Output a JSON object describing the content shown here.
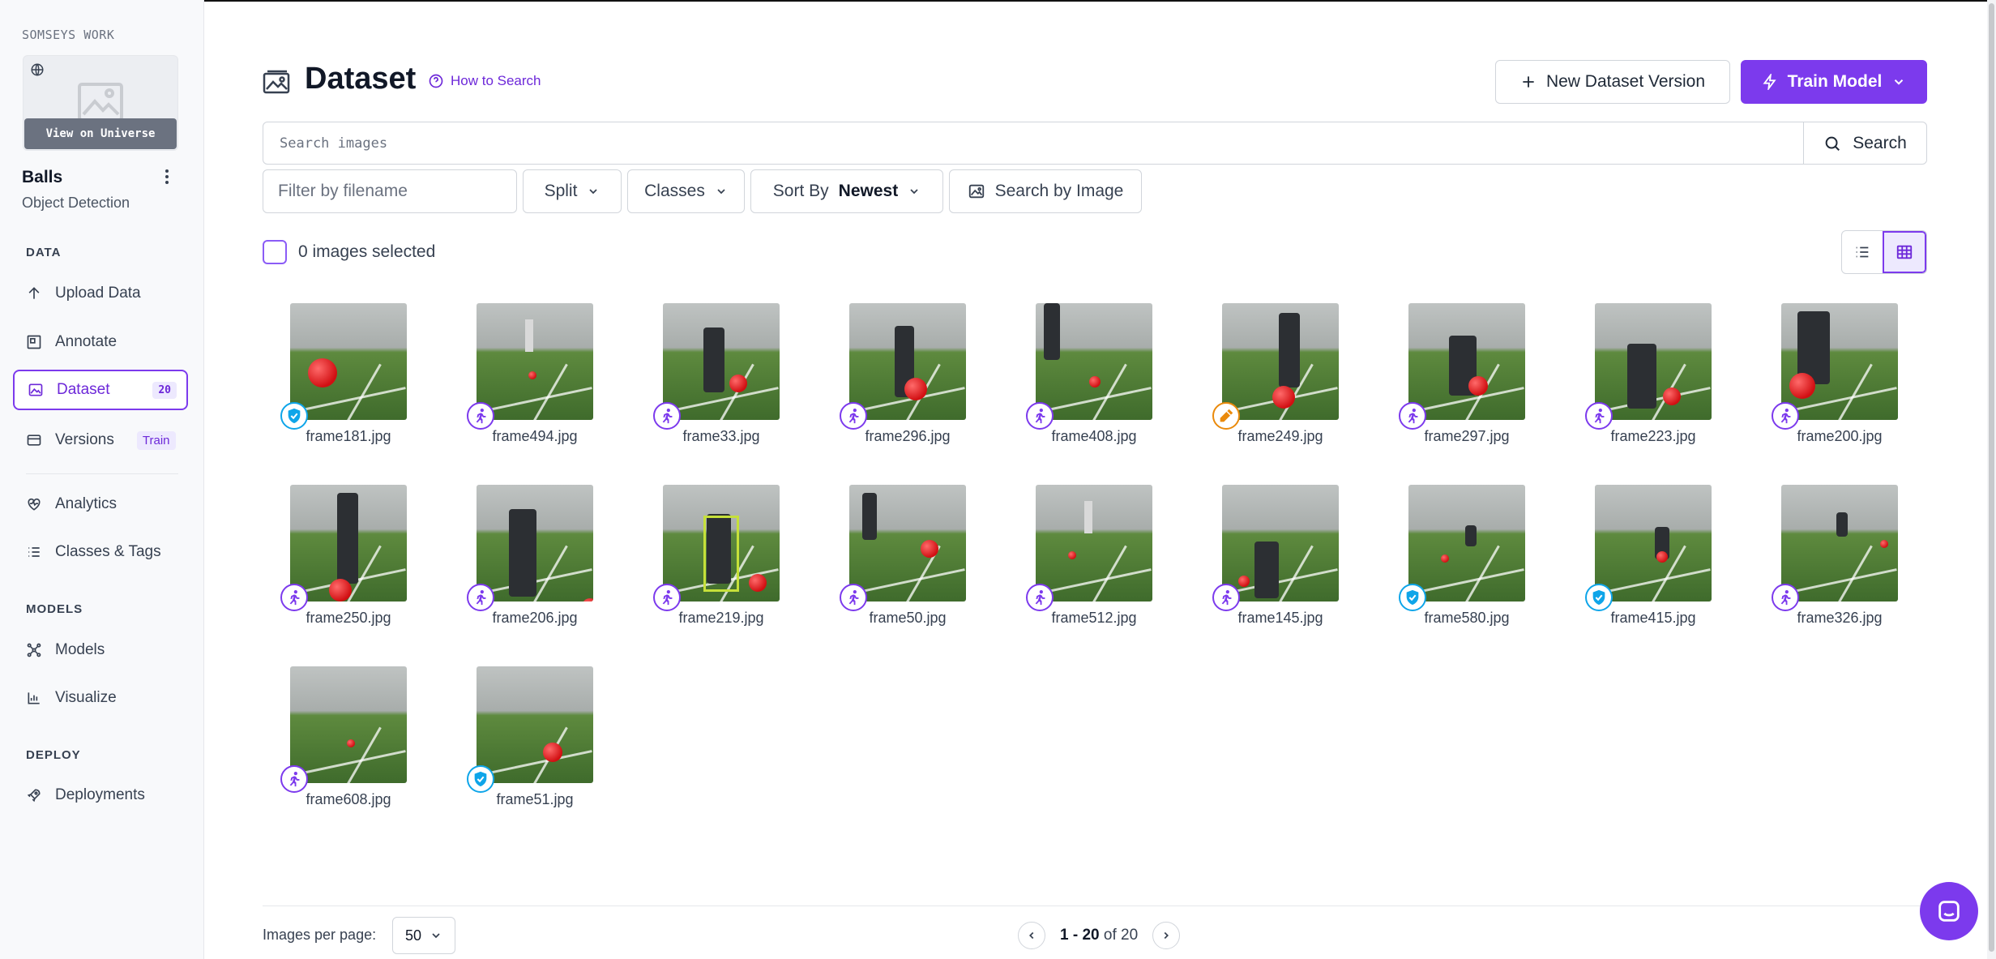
{
  "workspace": {
    "name": "SOMSEYS WORK",
    "view_universe": "View on Universe"
  },
  "project": {
    "name": "Balls",
    "type": "Object Detection"
  },
  "sidebar": {
    "sections": {
      "data": "DATA",
      "models": "MODELS",
      "deploy": "DEPLOY"
    },
    "items": {
      "upload": "Upload Data",
      "annotate": "Annotate",
      "dataset": "Dataset",
      "dataset_count": "20",
      "versions": "Versions",
      "versions_badge": "Train",
      "analytics": "Analytics",
      "classes": "Classes & Tags",
      "models": "Models",
      "visualize": "Visualize",
      "deployments": "Deployments"
    }
  },
  "header": {
    "title": "Dataset",
    "how_to_search": "How to Search",
    "new_version": "New Dataset Version",
    "train_model": "Train Model"
  },
  "search": {
    "placeholder": "Search images",
    "button": "Search"
  },
  "filters": {
    "filename_placeholder": "Filter by filename",
    "split": "Split",
    "classes": "Classes",
    "sort_label": "Sort By",
    "sort_value": "Newest",
    "search_by_image": "Search by Image"
  },
  "selection": {
    "text": "0 images selected"
  },
  "images": [
    {
      "name": "frame181.jpg",
      "status": "approved"
    },
    {
      "name": "frame494.jpg",
      "status": "run"
    },
    {
      "name": "frame33.jpg",
      "status": "run"
    },
    {
      "name": "frame296.jpg",
      "status": "run"
    },
    {
      "name": "frame408.jpg",
      "status": "run"
    },
    {
      "name": "frame249.jpg",
      "status": "annotating"
    },
    {
      "name": "frame297.jpg",
      "status": "run"
    },
    {
      "name": "frame223.jpg",
      "status": "run"
    },
    {
      "name": "frame200.jpg",
      "status": "run"
    },
    {
      "name": "frame250.jpg",
      "status": "run"
    },
    {
      "name": "frame206.jpg",
      "status": "run"
    },
    {
      "name": "frame219.jpg",
      "status": "run"
    },
    {
      "name": "frame50.jpg",
      "status": "run"
    },
    {
      "name": "frame512.jpg",
      "status": "run"
    },
    {
      "name": "frame145.jpg",
      "status": "run"
    },
    {
      "name": "frame580.jpg",
      "status": "approved"
    },
    {
      "name": "frame415.jpg",
      "status": "approved"
    },
    {
      "name": "frame326.jpg",
      "status": "run"
    },
    {
      "name": "frame608.jpg",
      "status": "run"
    },
    {
      "name": "frame51.jpg",
      "status": "approved"
    }
  ],
  "footer": {
    "per_page_label": "Images per page:",
    "per_page_value": "50",
    "range": "1 - 20",
    "of_label": "of 20"
  },
  "colors": {
    "accent": "#7c3aed",
    "approved": "#0ea5e9",
    "annotating": "#ea8a0b"
  }
}
